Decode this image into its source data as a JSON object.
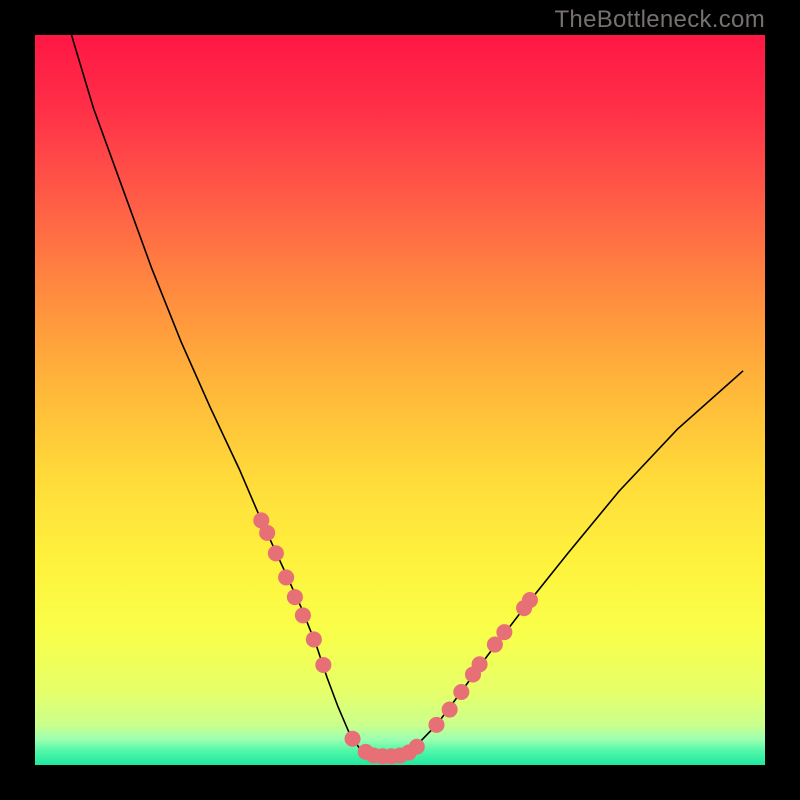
{
  "watermark_text": "TheBottleneck.com",
  "colors": {
    "frame": "#000000",
    "curve": "#000000",
    "dot_fill": "#e77076",
    "dot_stroke": "#e77076",
    "gradient_stops": [
      {
        "offset": 0.0,
        "color": "#ff1744"
      },
      {
        "offset": 0.1,
        "color": "#ff2f48"
      },
      {
        "offset": 0.22,
        "color": "#ff5a47"
      },
      {
        "offset": 0.35,
        "color": "#ff8a3f"
      },
      {
        "offset": 0.48,
        "color": "#ffb63a"
      },
      {
        "offset": 0.6,
        "color": "#ffd93a"
      },
      {
        "offset": 0.72,
        "color": "#fff23d"
      },
      {
        "offset": 0.82,
        "color": "#f8ff4a"
      },
      {
        "offset": 0.9,
        "color": "#e6ff6a"
      },
      {
        "offset": 0.945,
        "color": "#caff8c"
      },
      {
        "offset": 0.965,
        "color": "#9cffb0"
      },
      {
        "offset": 0.98,
        "color": "#54f7a8"
      },
      {
        "offset": 1.0,
        "color": "#1de9a0"
      }
    ]
  },
  "chart_data": {
    "type": "line",
    "title": "",
    "xlabel": "",
    "ylabel": "",
    "xlim": [
      0,
      100
    ],
    "ylim": [
      0,
      100
    ],
    "series": [
      {
        "name": "bottleneck-curve",
        "x": [
          5,
          8,
          12,
          16,
          20,
          24,
          28,
          31,
          34,
          36.5,
          38.5,
          40,
          41.5,
          43,
          44.5,
          46.5,
          49,
          52,
          55,
          58,
          62,
          67,
          73,
          80,
          88,
          97
        ],
        "y": [
          100,
          90,
          79,
          68,
          58,
          49,
          40.5,
          33.5,
          27,
          21.5,
          16.5,
          12,
          8,
          4.5,
          2.2,
          1.2,
          1.2,
          2.4,
          5.5,
          9.5,
          15,
          21.5,
          29,
          37.5,
          46,
          54
        ]
      }
    ],
    "dots_left": [
      {
        "x": 31.0,
        "y": 33.5
      },
      {
        "x": 31.8,
        "y": 31.8
      },
      {
        "x": 33.0,
        "y": 29.0
      },
      {
        "x": 34.4,
        "y": 25.7
      },
      {
        "x": 35.6,
        "y": 23.0
      },
      {
        "x": 36.7,
        "y": 20.5
      },
      {
        "x": 38.2,
        "y": 17.2
      },
      {
        "x": 39.5,
        "y": 13.7
      }
    ],
    "dots_right": [
      {
        "x": 55.0,
        "y": 5.5
      },
      {
        "x": 56.8,
        "y": 7.6
      },
      {
        "x": 58.4,
        "y": 10.0
      },
      {
        "x": 60.0,
        "y": 12.4
      },
      {
        "x": 60.9,
        "y": 13.8
      },
      {
        "x": 63.0,
        "y": 16.5
      },
      {
        "x": 64.3,
        "y": 18.2
      },
      {
        "x": 67.0,
        "y": 21.5
      },
      {
        "x": 67.8,
        "y": 22.6
      }
    ],
    "dots_bottom": [
      {
        "x": 43.5,
        "y": 3.6
      },
      {
        "x": 45.3,
        "y": 1.8
      },
      {
        "x": 46.4,
        "y": 1.3
      },
      {
        "x": 47.6,
        "y": 1.2
      },
      {
        "x": 48.8,
        "y": 1.2
      },
      {
        "x": 50.0,
        "y": 1.3
      },
      {
        "x": 51.2,
        "y": 1.7
      },
      {
        "x": 52.3,
        "y": 2.5
      }
    ]
  }
}
